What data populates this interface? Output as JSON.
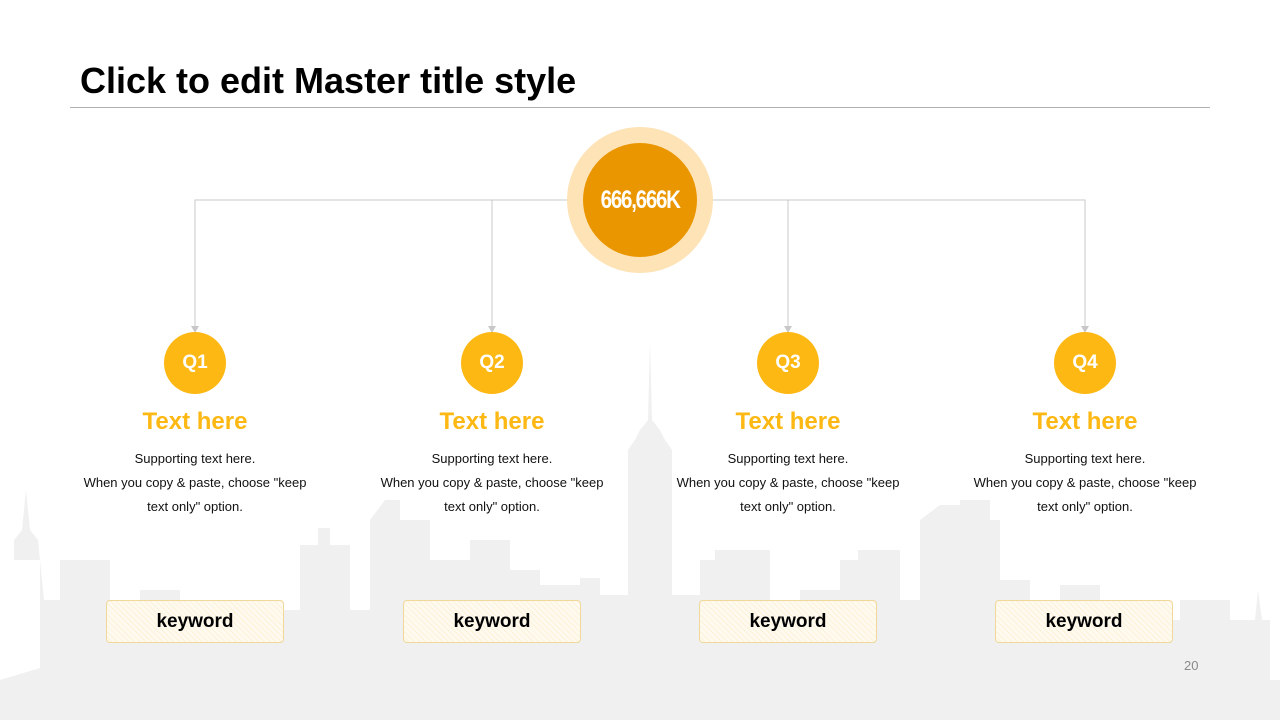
{
  "slide": {
    "title": "Click to edit Master title style",
    "page_number": "20"
  },
  "hub": {
    "value": "666,666K"
  },
  "quarters": [
    {
      "badge": "Q1",
      "heading": "Text here",
      "body": [
        "Supporting  text here.",
        "When  you copy & paste, choose \"keep",
        "text only\" option."
      ],
      "keyword": "keyword"
    },
    {
      "badge": "Q2",
      "heading": "Text here",
      "body": [
        "Supporting  text here.",
        "When  you copy & paste, choose \"keep",
        "text only\" option."
      ],
      "keyword": "keyword"
    },
    {
      "badge": "Q3",
      "heading": "Text here",
      "body": [
        "Supporting  text here.",
        "When  you copy & paste, choose \"keep",
        "text only\" option."
      ],
      "keyword": "keyword"
    },
    {
      "badge": "Q4",
      "heading": "Text here",
      "body": [
        "Supporting  text here.",
        "When  you copy & paste, choose \"keep",
        "text only\" option."
      ],
      "keyword": "keyword"
    }
  ],
  "colors": {
    "accent": "#fdb813",
    "hub": "#ea9600",
    "hub_ring": "#fde3b6",
    "skyline": "#f0f0f0"
  }
}
